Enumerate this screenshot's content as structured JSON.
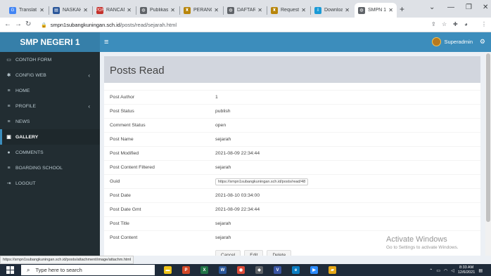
{
  "browser": {
    "tabs": [
      {
        "label": "Translat",
        "icon": "google-translate-icon",
        "color": "#4285f4",
        "glyph": "G",
        "active": false
      },
      {
        "label": "NASKAH",
        "icon": "document-icon",
        "color": "#2b579a",
        "glyph": "▤",
        "active": false
      },
      {
        "label": "RANCAN",
        "icon": "pdf-icon",
        "color": "#c4302b",
        "glyph": "PDF",
        "active": false
      },
      {
        "label": "Publikas",
        "icon": "globe-icon",
        "color": "#5f6368",
        "glyph": "◍",
        "active": false
      },
      {
        "label": "PERANC",
        "icon": "government-icon",
        "color": "#b8860b",
        "glyph": "♜",
        "active": false
      },
      {
        "label": "DAFTAR",
        "icon": "globe-icon",
        "color": "#5f6368",
        "glyph": "◍",
        "active": false
      },
      {
        "label": "Request",
        "icon": "government-icon",
        "color": "#b8860b",
        "glyph": "♜",
        "active": false
      },
      {
        "label": "Downloa",
        "icon": "download-site-icon",
        "color": "#1a9ad6",
        "glyph": "⇩",
        "active": false
      },
      {
        "label": "SMPN 1",
        "icon": "globe-icon",
        "color": "#5f6368",
        "glyph": "◍",
        "active": true
      }
    ],
    "url_host": "smpn1subangkuningan.sch.id",
    "url_path": "/posts/read/sejarah.html",
    "status_url": "https://smpn1subangkuningan.sch.id/posts/attachment/image/attachm.html"
  },
  "app": {
    "brand": "SMP NEGERI 1",
    "user_name": "Superadmin",
    "sidebar": [
      {
        "label": "CONTOH FORM",
        "icon": "keyboard-icon",
        "glyph": "▭",
        "chevron": false,
        "active": false
      },
      {
        "label": "CONFIG WEB",
        "icon": "gear-icon",
        "glyph": "✱",
        "chevron": true,
        "active": false
      },
      {
        "label": "HOME",
        "icon": "list-icon",
        "glyph": "≡",
        "chevron": false,
        "active": false
      },
      {
        "label": "PROFILE",
        "icon": "list-icon",
        "glyph": "≡",
        "chevron": true,
        "active": false
      },
      {
        "label": "NEWS",
        "icon": "list-icon",
        "glyph": "≡",
        "chevron": false,
        "active": false
      },
      {
        "label": "GALLERY",
        "icon": "image-icon",
        "glyph": "▣",
        "chevron": false,
        "active": true
      },
      {
        "label": "COMMENTS",
        "icon": "comment-icon",
        "glyph": "●",
        "chevron": false,
        "active": false
      },
      {
        "label": "BOARDING SCHOOL",
        "icon": "list-icon",
        "glyph": "≡",
        "chevron": false,
        "active": false
      },
      {
        "label": "LOGOUT",
        "icon": "sign-out-icon",
        "glyph": "⇥",
        "chevron": false,
        "active": false
      }
    ],
    "page_title": "Posts Read",
    "details": [
      {
        "label": "Post Author",
        "value": "1"
      },
      {
        "label": "Post Status",
        "value": "publish"
      },
      {
        "label": "Comment Status",
        "value": "open"
      },
      {
        "label": "Post Name",
        "value": "sejarah"
      },
      {
        "label": "Post Modified",
        "value": "2021-08-09 22:34:44"
      },
      {
        "label": "Post Content Filtered",
        "value": "sejarah"
      },
      {
        "label": "Guid",
        "value": "https://smpn1subangkuningan.sch.id/posts/read/48"
      },
      {
        "label": "Post Date",
        "value": "2021-08-10 03:34:00"
      },
      {
        "label": "Post Date Gmt",
        "value": "2021-08-09 22:34:44"
      },
      {
        "label": "Post Title",
        "value": "sejarah"
      },
      {
        "label": "Post Content",
        "value": "sejarah"
      }
    ],
    "buttons": {
      "cancel": "Cancel",
      "edit": "Edit",
      "delete": "Delete"
    }
  },
  "watermark": {
    "title": "Activate Windows",
    "subtitle": "Go to Settings to activate Windows."
  },
  "taskbar": {
    "search_placeholder": "Type here to search",
    "apps": [
      {
        "icon": "file-explorer-icon",
        "color": "#f0c419",
        "glyph": "▬"
      },
      {
        "icon": "powerpoint-icon",
        "color": "#d24726",
        "glyph": "P"
      },
      {
        "icon": "excel-icon",
        "color": "#217346",
        "glyph": "X"
      },
      {
        "icon": "word-icon",
        "color": "#2b579a",
        "glyph": "W"
      },
      {
        "icon": "chrome-icon",
        "color": "#dd4b39",
        "glyph": "◉"
      },
      {
        "icon": "app-icon",
        "color": "#5f6368",
        "glyph": "◆"
      },
      {
        "icon": "visio-icon",
        "color": "#3955a3",
        "glyph": "V"
      },
      {
        "icon": "edge-icon",
        "color": "#0a7cc1",
        "glyph": "e"
      },
      {
        "icon": "zoom-icon",
        "color": "#2d8cff",
        "glyph": "▶"
      },
      {
        "icon": "folder-icon",
        "color": "#e6a817",
        "glyph": "▰"
      }
    ],
    "time": "8:33 AM",
    "date": "12/6/2021"
  }
}
